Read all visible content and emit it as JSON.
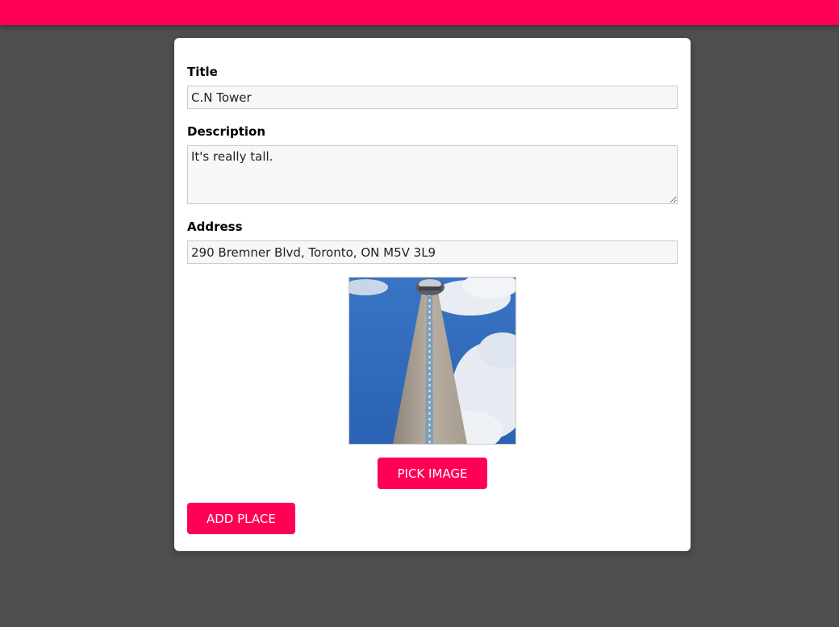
{
  "colors": {
    "accent": "#ff0055",
    "background": "#4e4e4e",
    "card": "#ffffff"
  },
  "form": {
    "title_label": "Title",
    "title_value": "C.N Tower",
    "description_label": "Description",
    "description_value": "It's really tall.",
    "address_label": "Address",
    "address_value": "290 Bremner Blvd, Toronto, ON M5V 3L9"
  },
  "image_preview": {
    "subject": "CN Tower photo"
  },
  "buttons": {
    "pick_image": "PICK IMAGE",
    "add_place": "ADD PLACE"
  }
}
